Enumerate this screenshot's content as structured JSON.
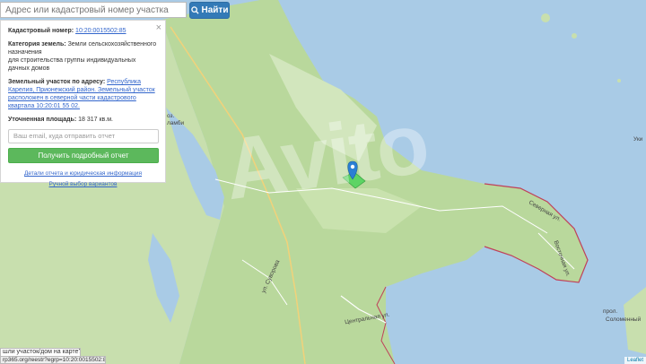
{
  "search": {
    "placeholder": "Адрес или кадастровый номер участка",
    "button_label": "Найти"
  },
  "panel": {
    "cadastral_label": "Кадастровый номер:",
    "cadastral_value": "10:20:0015502:85",
    "category_label": "Категория земель:",
    "category_value": "Земли сельскохозяйственного назначения",
    "category_value2": "для строительства группы индивидуальных дачных домов",
    "address_label": "Земельный участок по адресу:",
    "address_value": "Республика Карелия, Прионежский район. Земельный участок расположен в северной части кадастрового квартала 10:20:01 55 02.",
    "area_label": "Уточненная площадь:",
    "area_value": "18 317 кв.м.",
    "email_placeholder": "Ваш email, куда отправить отчет",
    "report_button": "Получить подробный отчет",
    "details_link": "Детали отчета и юридическая информация",
    "manual_link": "Ручной выбор вариантов",
    "close_symbol": "×"
  },
  "map": {
    "labels": {
      "severnaya": "Северная ул.",
      "vostochnaya": "Восточная ул.",
      "tsentralnaya": "Центральная ул.",
      "suvorova": "ул. Суворова",
      "prol": "прол.",
      "solomenny": "Соломенный",
      "uki": "Уки",
      "oz": "оз.",
      "lambi": "ламби"
    },
    "watermark": "Avito",
    "attribution": "Leaflet"
  },
  "bottom": {
    "tip_text": "шли участок/дом на карте?",
    "url_text": "rp365.org/reestr?egrp=10:20:0015502:85"
  },
  "colors": {
    "water": "#a9cbe6",
    "land": "#c8dfae",
    "forest": "#b6d59a",
    "boundary": "#c0405a",
    "marker": "#2a7fd4",
    "parcel": "#4cd35a"
  }
}
